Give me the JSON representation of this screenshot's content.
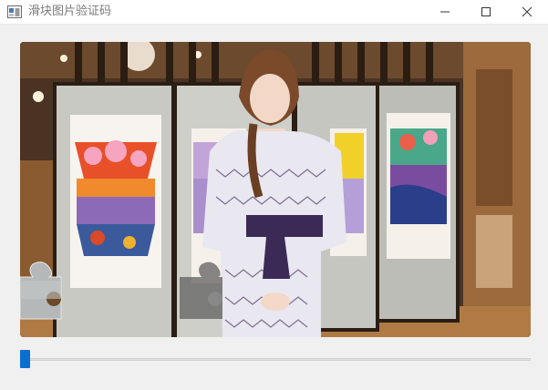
{
  "window": {
    "title": "滑块图片验证码",
    "app_icon": "app-window-icon",
    "controls": [
      "minimize-icon",
      "maximize-icon",
      "close-icon"
    ]
  },
  "captcha": {
    "image_description_icon": "captcha-photo",
    "puzzle_piece_icon": "puzzle-piece-icon",
    "puzzle_slot_icon": "puzzle-slot-icon"
  },
  "slider": {
    "value": 0,
    "accent_color": "#0a6fd0"
  }
}
